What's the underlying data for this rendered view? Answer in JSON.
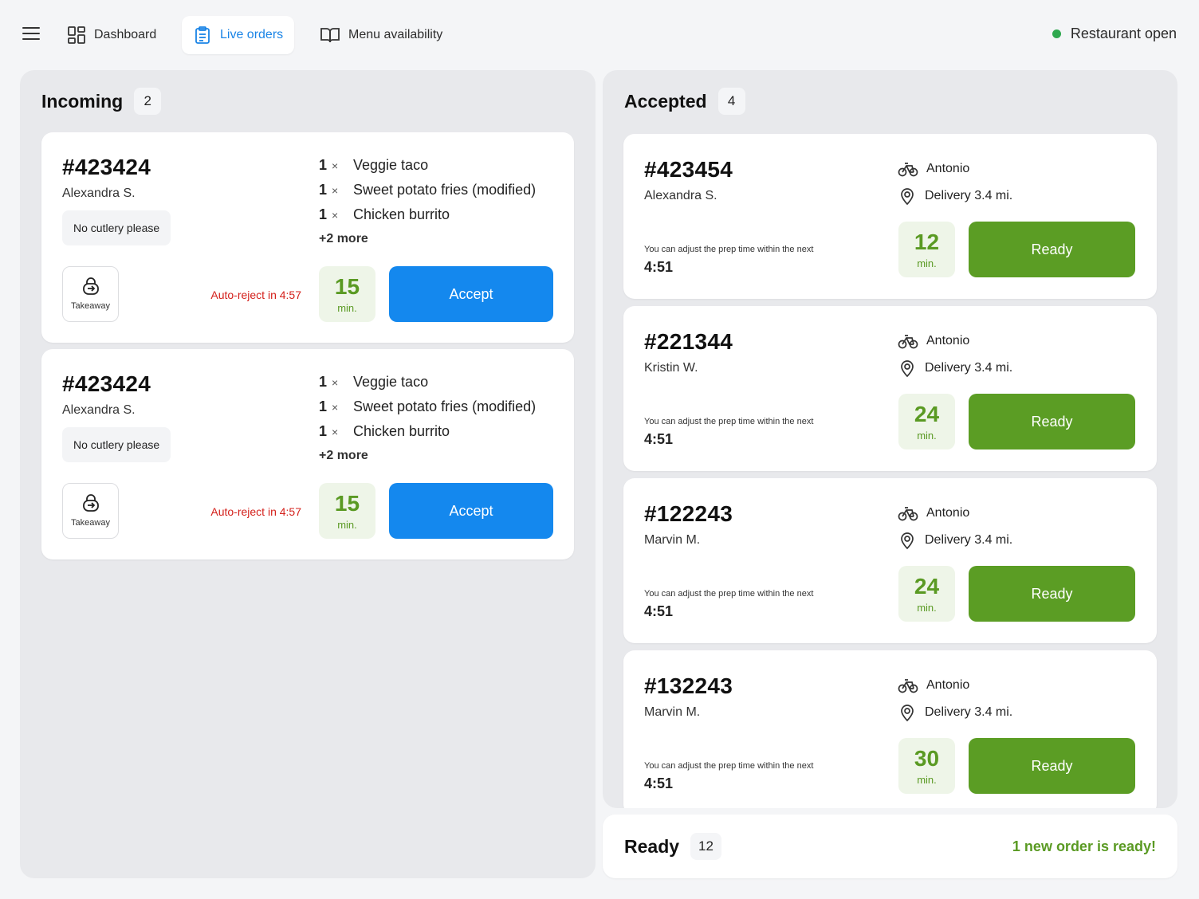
{
  "nav": {
    "tabs": [
      {
        "label": "Dashboard",
        "icon": "dashboard-grid-icon",
        "active": false
      },
      {
        "label": "Live orders",
        "icon": "clipboard-icon",
        "active": true
      },
      {
        "label": "Menu availability",
        "icon": "open-book-icon",
        "active": false
      }
    ],
    "status": {
      "label": "Restaurant open",
      "color": "#2fa84f"
    }
  },
  "colors": {
    "accent_blue": "#1488ee",
    "ready_green": "#5b9d24",
    "prep_green": "#5a9a23",
    "warning_red": "#d4201b"
  },
  "incoming": {
    "title": "Incoming",
    "count": "2",
    "orders": [
      {
        "number": "#423424",
        "customer": "Alexandra S.",
        "note": "No cutlery please",
        "items": [
          {
            "qty": "1",
            "x": "×",
            "name": "Veggie taco"
          },
          {
            "qty": "1",
            "x": "×",
            "name": "Sweet potato fries (modified)"
          },
          {
            "qty": "1",
            "x": "×",
            "name": "Chicken burrito"
          }
        ],
        "more": "+2 more",
        "type": "Takeaway",
        "auto_reject": "Auto-reject in 4:57",
        "prep_time": "15",
        "prep_unit": "min.",
        "action": "Accept"
      },
      {
        "number": "#423424",
        "customer": "Alexandra S.",
        "note": "No cutlery please",
        "items": [
          {
            "qty": "1",
            "x": "×",
            "name": "Veggie taco"
          },
          {
            "qty": "1",
            "x": "×",
            "name": "Sweet potato fries (modified)"
          },
          {
            "qty": "1",
            "x": "×",
            "name": "Chicken burrito"
          }
        ],
        "more": "+2 more",
        "type": "Takeaway",
        "auto_reject": "Auto-reject in 4:57",
        "prep_time": "15",
        "prep_unit": "min.",
        "action": "Accept"
      }
    ]
  },
  "accepted": {
    "title": "Accepted",
    "count": "4",
    "orders": [
      {
        "number": "#423454",
        "customer": "Alexandra S.",
        "rider": "Antonio",
        "delivery": "Delivery 3.4 mi.",
        "adjust_text": "You can adjust the prep time within the next",
        "countdown": "4:51",
        "prep_time": "12",
        "prep_unit": "min.",
        "action": "Ready"
      },
      {
        "number": "#221344",
        "customer": "Kristin W.",
        "rider": "Antonio",
        "delivery": "Delivery 3.4 mi.",
        "adjust_text": "You can adjust the prep time within the next",
        "countdown": "4:51",
        "prep_time": "24",
        "prep_unit": "min.",
        "action": "Ready"
      },
      {
        "number": "#122243",
        "customer": "Marvin M.",
        "rider": "Antonio",
        "delivery": "Delivery 3.4 mi.",
        "adjust_text": "You can adjust the prep time within the next",
        "countdown": "4:51",
        "prep_time": "24",
        "prep_unit": "min.",
        "action": "Ready"
      },
      {
        "number": "#132243",
        "customer": "Marvin M.",
        "rider": "Antonio",
        "delivery": "Delivery 3.4 mi.",
        "adjust_text": "You can adjust the prep time within the next",
        "countdown": "4:51",
        "prep_time": "30",
        "prep_unit": "min.",
        "action": "Ready"
      }
    ]
  },
  "ready": {
    "title": "Ready",
    "count": "12",
    "message": "1 new order is ready!"
  }
}
